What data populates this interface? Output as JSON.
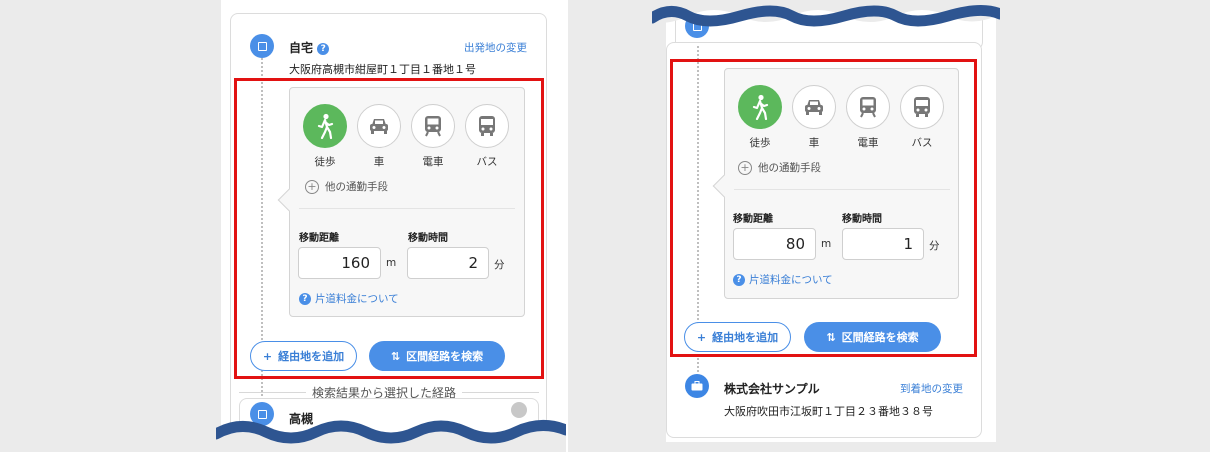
{
  "left_panel": {
    "origin": {
      "name": "自宅",
      "address": "大阪府高槻市紺屋町１丁目１番地１号",
      "change_link": "出発地の変更"
    },
    "modes": [
      {
        "label": "徒歩",
        "icon": "walking-icon",
        "active": true
      },
      {
        "label": "車",
        "icon": "car-icon",
        "active": false
      },
      {
        "label": "電車",
        "icon": "train-icon",
        "active": false
      },
      {
        "label": "バス",
        "icon": "bus-icon",
        "active": false
      }
    ],
    "other_modes_label": "他の通勤手段",
    "distance_label": "移動距離",
    "distance_value": "160",
    "distance_unit": "m",
    "time_label": "移動時間",
    "time_value": "2",
    "time_unit": "分",
    "fare_link": "片道料金について",
    "add_waypoint_label": "経由地を追加",
    "search_route_label": "区間経路を検索",
    "separator_label": "検索結果から選択した経路",
    "next_stop_name": "高槻"
  },
  "right_panel": {
    "modes": [
      {
        "label": "徒歩",
        "icon": "walking-icon",
        "active": true
      },
      {
        "label": "車",
        "icon": "car-icon",
        "active": false
      },
      {
        "label": "電車",
        "icon": "train-icon",
        "active": false
      },
      {
        "label": "バス",
        "icon": "bus-icon",
        "active": false
      }
    ],
    "other_modes_label": "他の通勤手段",
    "distance_label": "移動距離",
    "distance_value": "80",
    "distance_unit": "m",
    "time_label": "移動時間",
    "time_value": "1",
    "time_unit": "分",
    "fare_link": "片道料金について",
    "add_waypoint_label": "経由地を追加",
    "search_route_label": "区間経路を検索",
    "destination": {
      "name": "株式会社サンプル",
      "address": "大阪府吹田市江坂町１丁目２３番地３８号",
      "change_link": "到着地の変更"
    }
  },
  "colors": {
    "accent": "#4a8fe7",
    "walk_active": "#5cb85c",
    "highlight": "#e21212",
    "wave": "#2e5591"
  }
}
